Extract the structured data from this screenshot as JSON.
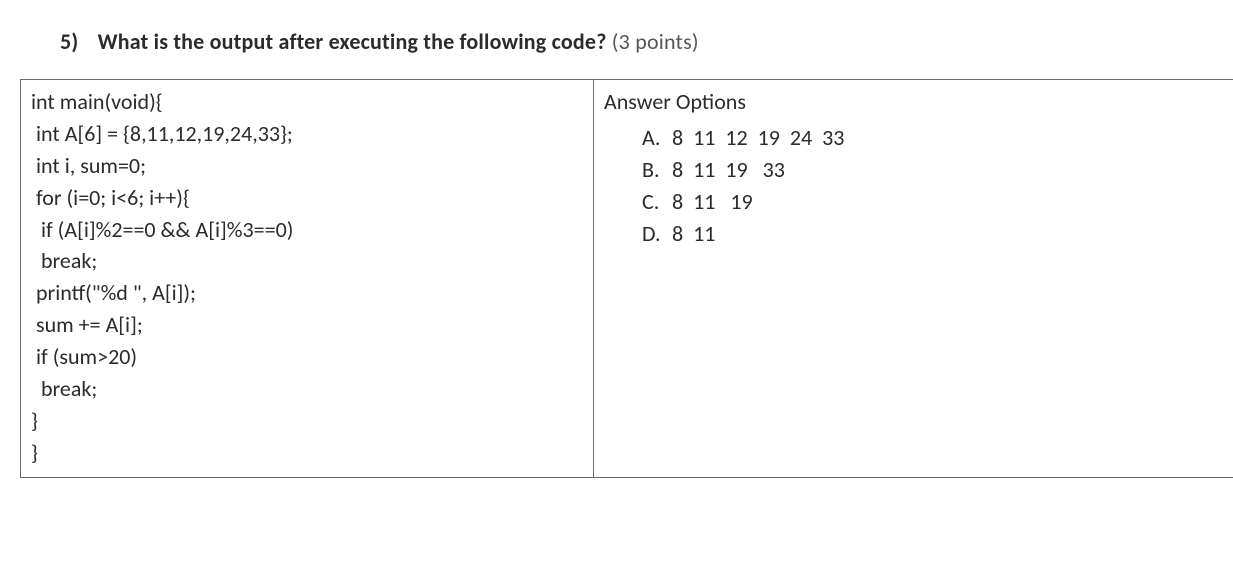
{
  "question": {
    "number": "5)",
    "prompt_bold": "What is the output after executing the following code?",
    "points": "(3 points)"
  },
  "code_lines": [
    "int main(void){",
    " int A[6] = {8,11,12,19,24,33};",
    " int i, sum=0;",
    " for (i=0; i<6; i++){",
    "  if (A[i]%2==0 && A[i]%3==0)",
    "  break;",
    " printf(\"%d \", A[i]);",
    " sum += A[i];",
    " if (sum>20)",
    "  break;",
    "}",
    "}"
  ],
  "answers": {
    "title": "Answer Options",
    "options": [
      {
        "letter": "A.",
        "text": "8  11  12  19  24  33"
      },
      {
        "letter": "B.",
        "text": "8  11  19   33"
      },
      {
        "letter": "C.",
        "text": "8  11   19"
      },
      {
        "letter": "D.",
        "text": "8  11"
      }
    ]
  }
}
